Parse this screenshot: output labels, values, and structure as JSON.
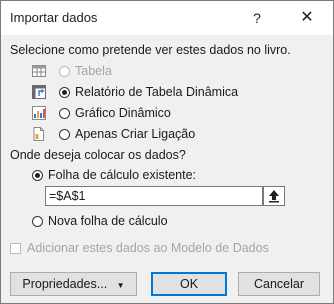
{
  "dialog": {
    "title": "Importar dados",
    "help_glyph": "?",
    "close_glyph": "✕"
  },
  "view_section": {
    "heading": "Selecione como pretende ver estes dados no livro.",
    "options": {
      "table": {
        "label": "Tabela",
        "selected": false,
        "enabled": false
      },
      "pivot_table": {
        "label": "Relatório de Tabela Dinâmica",
        "selected": true,
        "enabled": true
      },
      "pivot_chart": {
        "label": "Gráfico Dinâmico",
        "selected": false,
        "enabled": true
      },
      "connection_only": {
        "label": "Apenas Criar Ligação",
        "selected": false,
        "enabled": true
      }
    }
  },
  "location_section": {
    "heading": "Onde deseja colocar os dados?",
    "existing_sheet": {
      "label": "Folha de cálculo existente:",
      "selected": true
    },
    "cell_reference": "=$A$1",
    "new_sheet": {
      "label": "Nova folha de cálculo",
      "selected": false
    }
  },
  "data_model": {
    "label": "Adicionar estes dados ao Modelo de Dados",
    "checked": false,
    "enabled": false
  },
  "buttons": {
    "properties": "Propriedades...",
    "ok": "OK",
    "cancel": "Cancelar"
  },
  "colors": {
    "default_button_border": "#0078d7",
    "disabled_text": "#a5a5a5",
    "dialog_background": "#f0f0f0"
  }
}
